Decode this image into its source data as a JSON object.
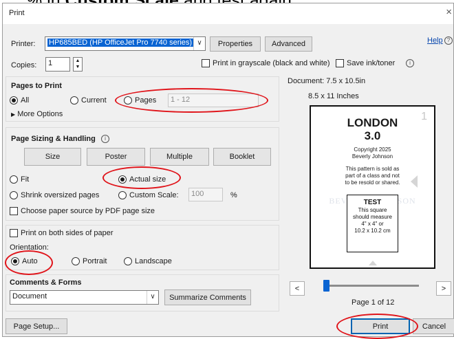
{
  "banner": {
    "prefix": "…% in ",
    "bold": "Custom Scale",
    "suffix": " and test again."
  },
  "window": {
    "title": "Print",
    "close_glyph": "×"
  },
  "printer": {
    "label": "Printer:",
    "value": "HP685BED (HP OfficeJet Pro 7740 series)",
    "properties_label": "Properties",
    "advanced_label": "Advanced",
    "help_label": "Help"
  },
  "copies": {
    "label": "Copies:",
    "value": "1",
    "grayscale_label": "Print in grayscale (black and white)",
    "save_ink_label": "Save ink/toner"
  },
  "pages_to_print": {
    "heading": "Pages to Print",
    "all_label": "All",
    "current_label": "Current",
    "pages_label": "Pages",
    "pages_value": "1 - 12",
    "more_options_label": "More Options",
    "selected": "All"
  },
  "sizing": {
    "heading": "Page Sizing & Handling",
    "size_label": "Size",
    "poster_label": "Poster",
    "multiple_label": "Multiple",
    "booklet_label": "Booklet",
    "fit_label": "Fit",
    "actual_size_label": "Actual size",
    "shrink_label": "Shrink oversized pages",
    "custom_scale_label": "Custom Scale:",
    "custom_scale_value": "100",
    "percent_label": "%",
    "paper_source_label": "Choose paper source by PDF page size",
    "selected": "Actual size"
  },
  "duplex": {
    "label": "Print on both sides of paper"
  },
  "orientation": {
    "heading": "Orientation:",
    "auto_label": "Auto",
    "portrait_label": "Portrait",
    "landscape_label": "Landscape",
    "selected": "Auto"
  },
  "comments": {
    "heading": "Comments & Forms",
    "value": "Document",
    "summarize_label": "Summarize Comments"
  },
  "preview": {
    "document_size": "Document: 7.5 x 10.5in",
    "paper_size": "8.5 x 11 Inches",
    "page_number_mark": "1",
    "title_line1": "LONDON",
    "title_line2": "3.0",
    "copyright_line1": "Copyright 2025",
    "copyright_line2": "Beverly Johnson",
    "notice_line1": "This pattern is sold as",
    "notice_line2": "part of a class and not",
    "notice_line3": "to be resold or shared.",
    "test_heading": "TEST",
    "test_line1": "This square",
    "test_line2": "should measure",
    "test_line3": "4\" x 4\" or",
    "test_line4": "10.2 x 10.2 cm",
    "watermark": "BEVERLY JOHNSON",
    "prev_label": "<",
    "next_label": ">",
    "page_indicator": "Page 1 of 12",
    "slider_position": 0.0
  },
  "footer": {
    "page_setup_label": "Page Setup...",
    "print_label": "Print",
    "cancel_label": "Cancel"
  },
  "colors": {
    "annotation": "#e0141a",
    "selection": "#0a64d2",
    "print_border": "#0063b1"
  }
}
